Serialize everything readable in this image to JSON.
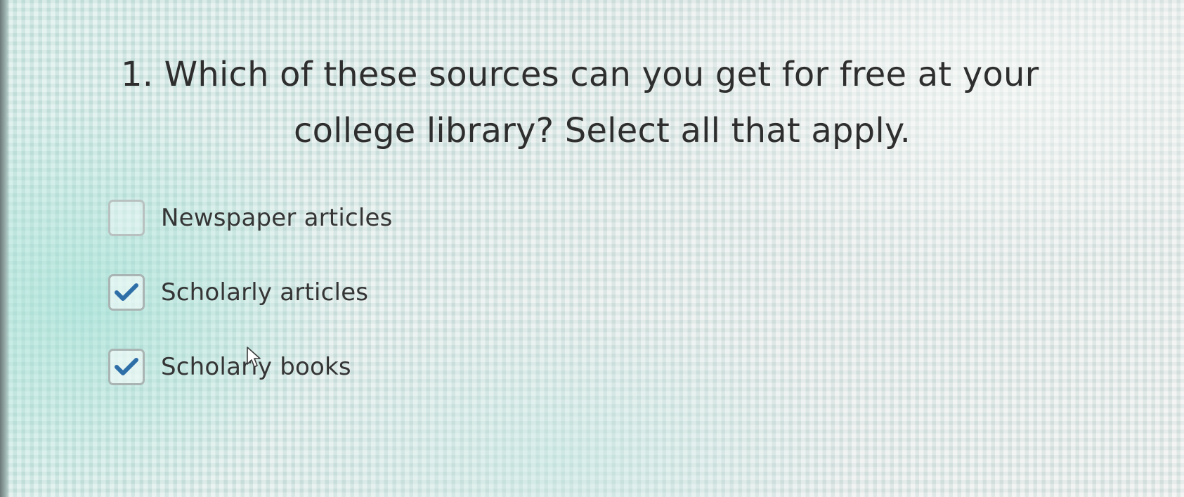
{
  "question": {
    "number": "1.",
    "text_line1": "Which of these sources can you get for free at your",
    "text_line2": "college library? Select all that apply."
  },
  "options": [
    {
      "label": "Newspaper articles",
      "checked": false
    },
    {
      "label": "Scholarly articles",
      "checked": true
    },
    {
      "label": "Scholarly books",
      "checked": true
    }
  ],
  "colors": {
    "check_mark": "#2f6fa8",
    "checkbox_border": "#b9c1c0"
  },
  "icons": {
    "check": "check-icon",
    "cursor": "mouse-pointer-icon"
  }
}
